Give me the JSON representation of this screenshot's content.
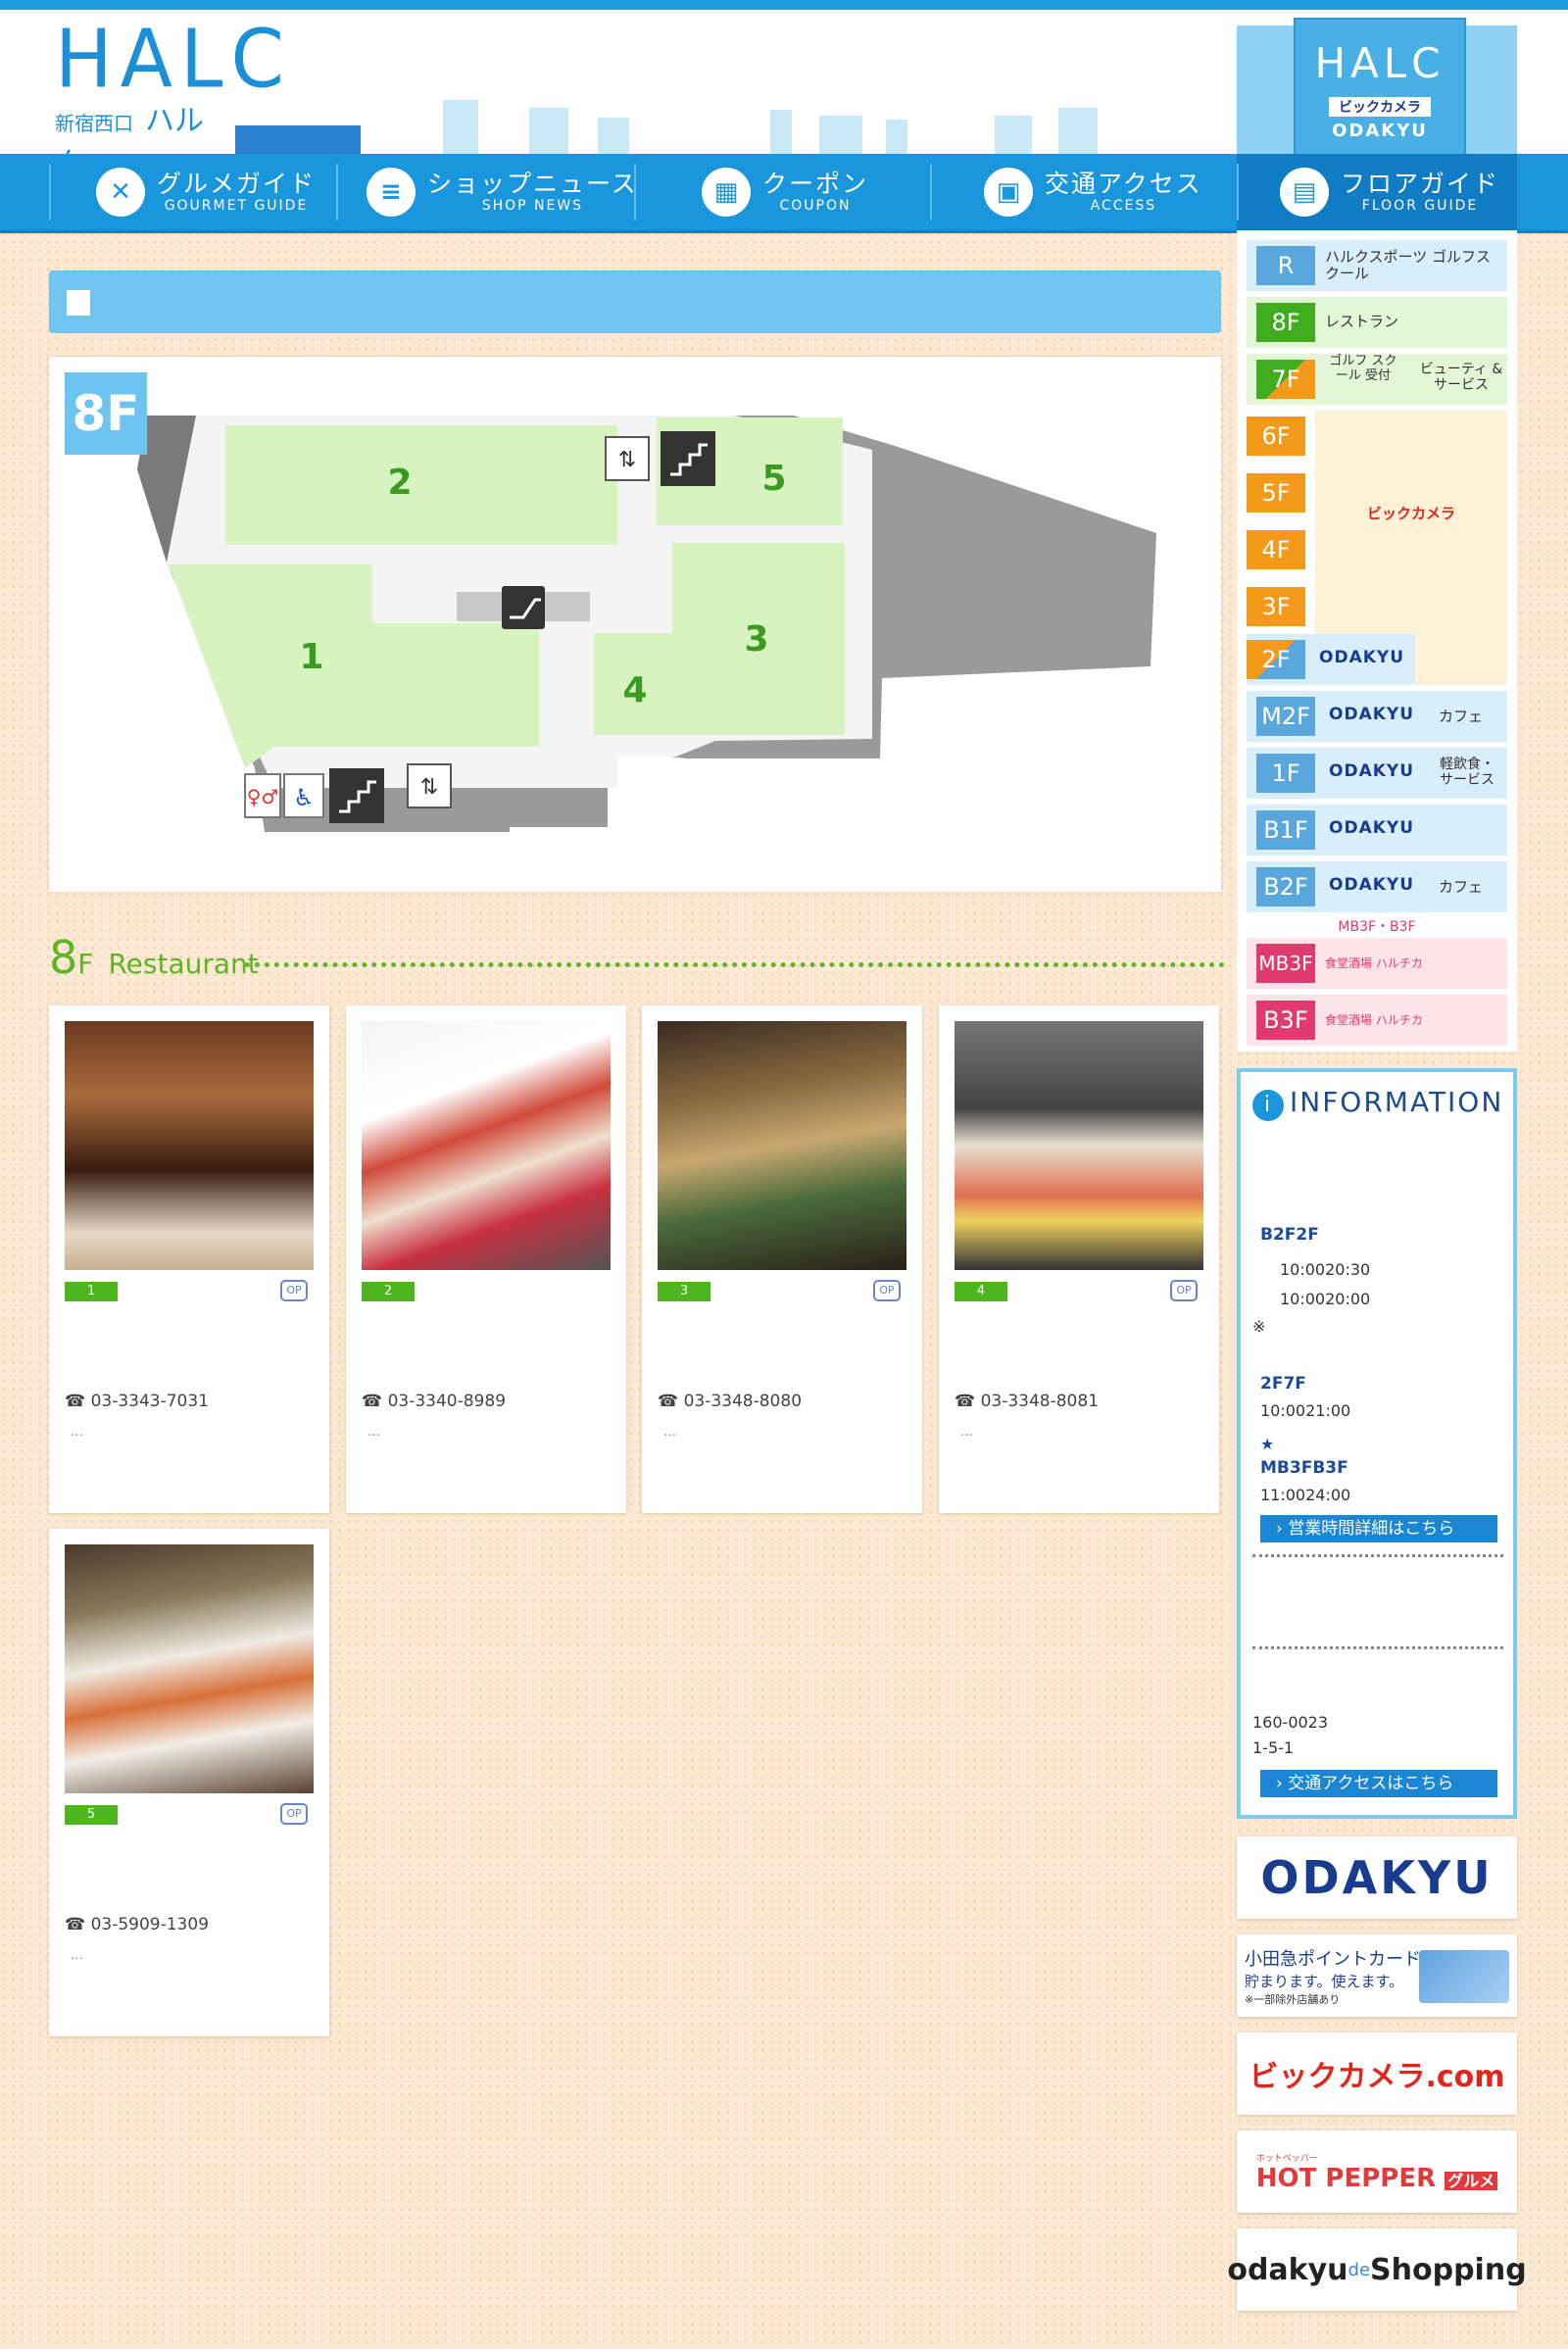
{
  "header": {
    "logo_main": "HALC",
    "logo_sub1": "新宿西口",
    "logo_sub2": "ハルク",
    "building_logo": "HALC",
    "building_sub": "ビックカメラ",
    "building_odakyu": "ODAKYU"
  },
  "nav": [
    {
      "label": "グルメガイド",
      "sub": "GOURMET GUIDE",
      "icon": "fork-knife-icon"
    },
    {
      "label": "ショップニュース",
      "sub": "SHOP NEWS",
      "icon": "document-icon"
    },
    {
      "label": "クーポン",
      "sub": "COUPON",
      "icon": "ticket-icon"
    },
    {
      "label": "交通アクセス",
      "sub": "ACCESS",
      "icon": "train-icon"
    },
    {
      "label": "フロアガイド",
      "sub": "FLOOR GUIDE",
      "icon": "building-icon"
    }
  ],
  "page_title": "",
  "map": {
    "floor": "8F",
    "areas": [
      "1",
      "2",
      "3",
      "4",
      "5"
    ]
  },
  "section": {
    "floor_num": "8",
    "floor_suffix": "F",
    "label": "Restaurant"
  },
  "shops": [
    {
      "num": "1",
      "name": "",
      "tel": "☎ 03-3343-7031",
      "more": "…",
      "op": "OP"
    },
    {
      "num": "2",
      "name": "",
      "tel": "☎ 03-3340-8989",
      "more": "…",
      "op": "OP"
    },
    {
      "num": "3",
      "name": "",
      "tel": "☎ 03-3348-8080",
      "more": "…",
      "op": "OP"
    },
    {
      "num": "4",
      "name": "",
      "tel": "☎ 03-3348-8081",
      "more": "…",
      "op": "OP"
    },
    {
      "num": "5",
      "name": "",
      "tel": "☎ 03-5909-1309",
      "more": "…",
      "op": "OP"
    }
  ],
  "floor_guide": [
    {
      "floor": "R",
      "label": "ハルクスポーツ ゴルフスクール",
      "color": "#5aa7dd"
    },
    {
      "floor": "8F",
      "label": "レストラン",
      "color": "#40ad1f"
    },
    {
      "floor": "7F",
      "label": "ゴルフ スクール 受付",
      "label2": "ビューティ &サービス",
      "color": "#40ad1f"
    },
    {
      "floor": "6F",
      "color": "#f39a1b"
    },
    {
      "floor": "5F",
      "label": "ビックカメラ",
      "color": "#f39a1b"
    },
    {
      "floor": "4F",
      "color": "#f39a1b"
    },
    {
      "floor": "3F",
      "color": "#f39a1b"
    },
    {
      "floor": "2F",
      "odakyu": "ODAKYU",
      "color": "#f39a1b"
    },
    {
      "floor": "M2F",
      "odakyu": "ODAKYU",
      "label": "カフェ",
      "color": "#5aa7dd"
    },
    {
      "floor": "1F",
      "odakyu": "ODAKYU",
      "label": "軽飲食・ サービス",
      "color": "#5aa7dd"
    },
    {
      "floor": "B1F",
      "odakyu": "ODAKYU",
      "color": "#5aa7dd"
    },
    {
      "floor": "B2F",
      "odakyu": "ODAKYU",
      "label": "カフェ",
      "color": "#5aa7dd"
    },
    {
      "floor": "MB3F",
      "label": "食堂酒場 ハルチカ",
      "color": "#e03a6e"
    },
    {
      "floor": "B3F",
      "label": "食堂酒場 ハルチカ",
      "color": "#e03a6e"
    }
  ],
  "floor_divider": "MB3F・B3F",
  "information": {
    "title": "INFORMATION",
    "hours_heading": "",
    "b2f_label": "B2F2F",
    "b2f_line1": "10:0020:30",
    "b2f_line2": "10:0020:00",
    "note_mark": "※",
    "f27_label": "2F7F",
    "f27_hours": "10:0021:00",
    "star": "★",
    "mb3_label": "MB3FB3F",
    "mb3_hours": "11:0024:00",
    "hours_button": "営業時間詳細はこちら",
    "second_heading": "",
    "address_heading": "",
    "postal": "160-0023",
    "address": "1-5-1",
    "access_button": "交通アクセスはこちら"
  },
  "banners": {
    "odakyu": "ODAKYU",
    "point_card_l1": "小田急ポイントカード",
    "point_card_l2": "貯まります。使えます。",
    "point_card_l3": "※一部除外店舗あり",
    "biccamera": "ビックカメラ.com",
    "hotpepper_small": "ホットペッパー",
    "hotpepper": "HOT PEPPER",
    "hotpepper_gourmet": "グルメ",
    "odakyu_shopping_a": "odakyu",
    "odakyu_shopping_b": "de",
    "odakyu_shopping_c": "Shopping"
  }
}
